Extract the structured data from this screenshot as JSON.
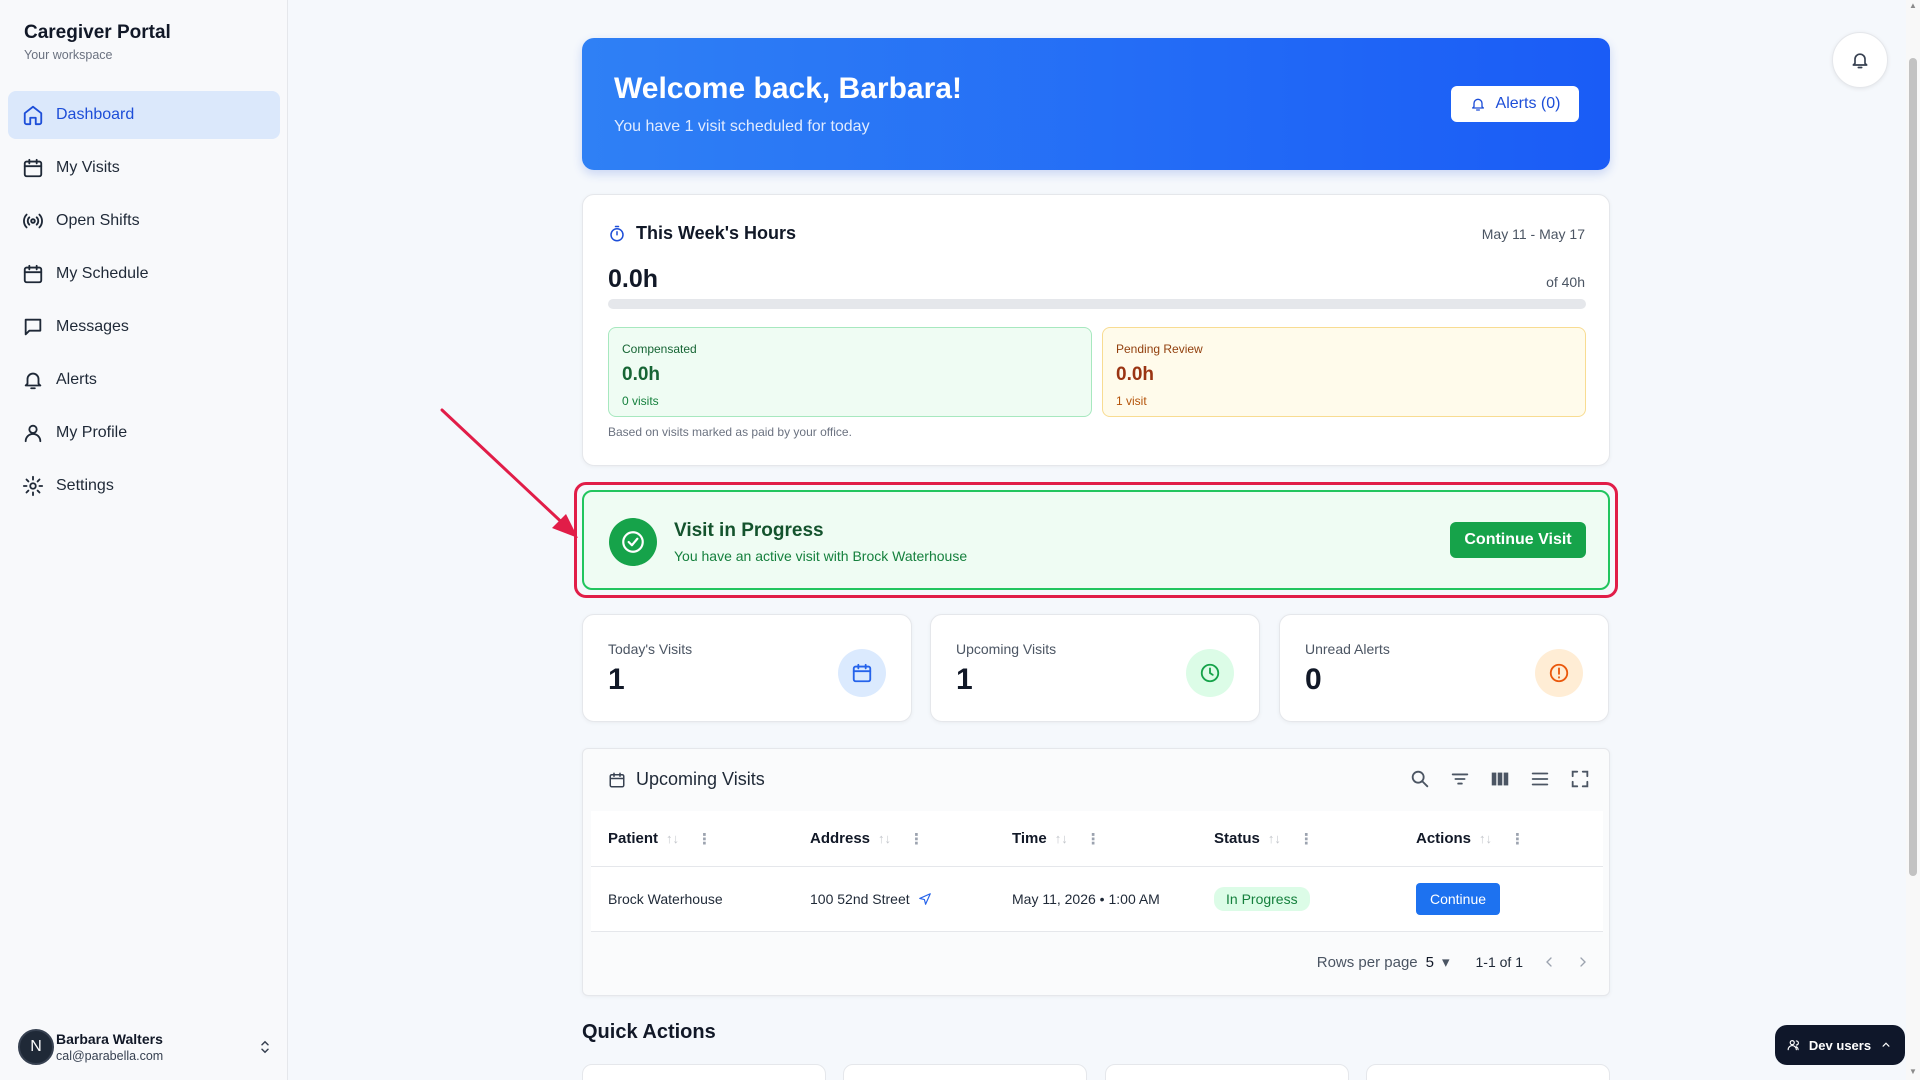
{
  "sidebar": {
    "brand_title": "Caregiver Portal",
    "brand_sub": "Your workspace",
    "items": [
      {
        "label": "Dashboard",
        "icon": "home-icon",
        "active": true
      },
      {
        "label": "My Visits",
        "icon": "calendar-icon"
      },
      {
        "label": "Open Shifts",
        "icon": "broadcast-icon"
      },
      {
        "label": "My Schedule",
        "icon": "calendar-icon"
      },
      {
        "label": "Messages",
        "icon": "message-icon"
      },
      {
        "label": "Alerts",
        "icon": "bell-icon"
      },
      {
        "label": "My Profile",
        "icon": "user-icon"
      },
      {
        "label": "Settings",
        "icon": "gear-icon"
      }
    ],
    "user": {
      "initial": "N",
      "name": "Barbara Walters",
      "email": "cal@parabella.com"
    }
  },
  "hero": {
    "title": "Welcome back, Barbara!",
    "subtitle": "You have 1 visit scheduled for today",
    "alerts_label": "Alerts (0)"
  },
  "hours": {
    "title": "This Week's Hours",
    "range": "May 11 - May 17",
    "total": "0.0h",
    "of": "of 40h",
    "progress_fraction": 0,
    "compensated": {
      "label": "Compensated",
      "value": "0.0h",
      "sub": "0 visits"
    },
    "pending": {
      "label": "Pending Review",
      "value": "0.0h",
      "sub": "1 visit"
    },
    "note": "Based on visits marked as paid by your office."
  },
  "visit_progress": {
    "title": "Visit in Progress",
    "subtitle": "You have an active visit with Brock Waterhouse",
    "button": "Continue Visit"
  },
  "stats": [
    {
      "label": "Today's Visits",
      "value": "1",
      "icon": "calendar-icon"
    },
    {
      "label": "Upcoming Visits",
      "value": "1",
      "icon": "clock-icon"
    },
    {
      "label": "Unread Alerts",
      "value": "0",
      "icon": "alert-circle-icon"
    }
  ],
  "upcoming": {
    "title": "Upcoming Visits",
    "columns": [
      "Patient",
      "Address",
      "Time",
      "Status",
      "Actions"
    ],
    "rows": [
      {
        "patient": "Brock Waterhouse",
        "address": "100 52nd Street",
        "time": "May 11, 2026 • 1:00 AM",
        "status": "In Progress",
        "action": "Continue"
      }
    ],
    "rows_per_page_label": "Rows per page",
    "rows_per_page": "5",
    "range": "1-1 of 1"
  },
  "quick_actions": {
    "title": "Quick Actions"
  },
  "dev_users": {
    "label": "Dev users"
  },
  "colors": {
    "accent": "#1d4ed8",
    "success": "#16a34a",
    "highlight": "#e11d48"
  }
}
